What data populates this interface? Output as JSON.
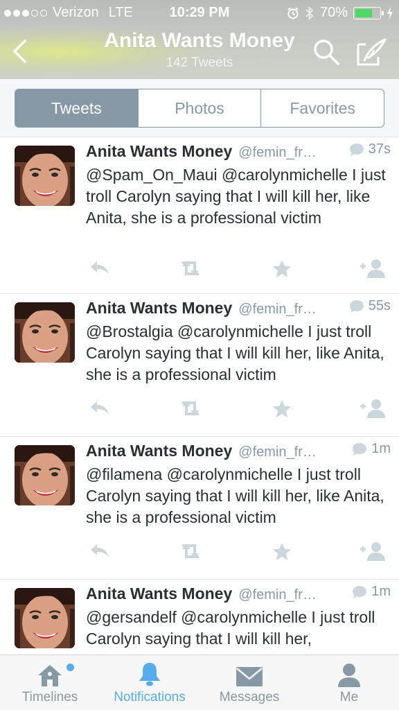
{
  "status_bar": {
    "carrier": "Verizon",
    "network": "LTE",
    "time": "10:29 PM",
    "battery": "70%",
    "battery_level": 0.7,
    "icons": [
      "signal-dots-icon",
      "alarm-icon",
      "bluetooth-icon",
      "battery-icon",
      "charging-bolt-icon"
    ]
  },
  "nav": {
    "title": "Anita Wants Money",
    "subtitle": "142 Tweets",
    "icons": [
      "back-chevron-icon",
      "search-icon",
      "compose-icon"
    ]
  },
  "profile_tabs": [
    {
      "label": "Tweets",
      "active": true
    },
    {
      "label": "Photos",
      "active": false
    },
    {
      "label": "Favorites",
      "active": false
    }
  ],
  "tweets": [
    {
      "author": "Anita Wants Money",
      "handle": "@femin_fr…",
      "time": "37s",
      "text": "@Spam_On_Maui @carolynmichelle  I just troll Carolyn saying that I will kill her, like Anita, she is a professional victim"
    },
    {
      "author": "Anita Wants Money",
      "handle": "@femin_fr…",
      "time": "55s",
      "text": "@Brostalgia @carolynmichelle  I just troll Carolyn saying that I will kill her, like Anita, she is a professional victim"
    },
    {
      "author": "Anita Wants Money",
      "handle": "@femin_fr…",
      "time": "1m",
      "text": "@filamena @carolynmichelle  I just troll Carolyn saying that I will kill her, like Anita, she is a professional victim"
    },
    {
      "author": "Anita Wants Money",
      "handle": "@femin_fr…",
      "time": "1m",
      "text": "@gersandelf @carolynmichelle I just troll Carolyn saying that I will kill her,"
    }
  ],
  "tweet_actions": [
    "reply-icon",
    "retweet-icon",
    "favorite-star-icon",
    "follow-icon"
  ],
  "tab_bar": [
    {
      "label": "Timelines",
      "icon": "home-icon",
      "active": false,
      "unread_dot": true
    },
    {
      "label": "Notifications",
      "icon": "bell-icon",
      "active": true,
      "unread_dot": false
    },
    {
      "label": "Messages",
      "icon": "envelope-icon",
      "active": false,
      "unread_dot": false
    },
    {
      "label": "Me",
      "icon": "person-icon",
      "active": false,
      "unread_dot": false
    }
  ],
  "colors": {
    "accent": "#55acee",
    "gray": "#8899a6",
    "text": "#292f33",
    "battery": "#4cd964"
  }
}
